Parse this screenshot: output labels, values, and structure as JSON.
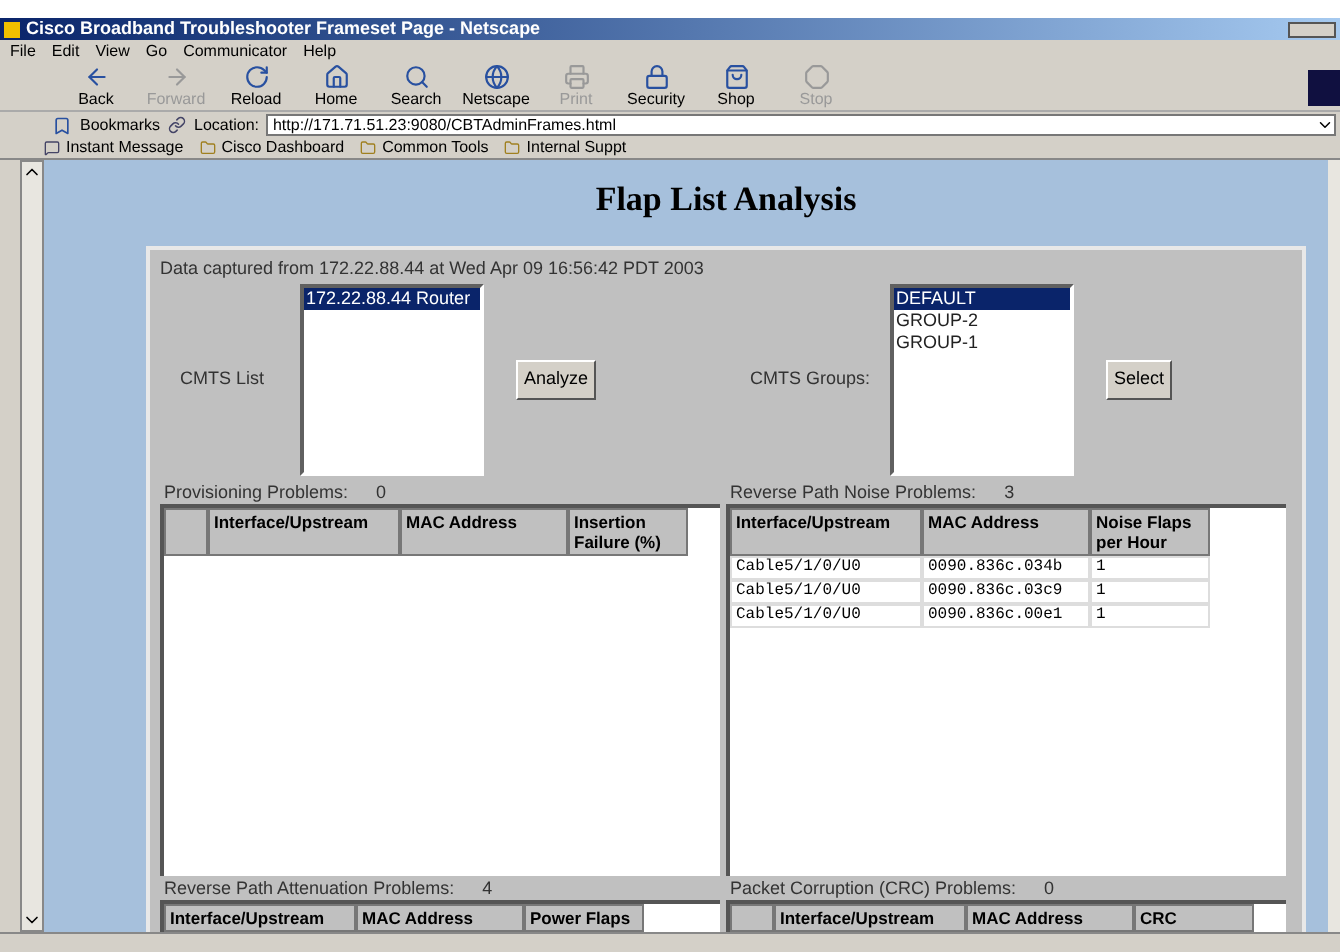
{
  "window": {
    "title": "Cisco Broadband Troubleshooter Frameset Page - Netscape"
  },
  "menu": [
    "File",
    "Edit",
    "View",
    "Go",
    "Communicator",
    "Help"
  ],
  "toolbar": [
    {
      "label": "Back",
      "disabled": false
    },
    {
      "label": "Forward",
      "disabled": true
    },
    {
      "label": "Reload",
      "disabled": false
    },
    {
      "label": "Home",
      "disabled": false
    },
    {
      "label": "Search",
      "disabled": false
    },
    {
      "label": "Netscape",
      "disabled": false
    },
    {
      "label": "Print",
      "disabled": true
    },
    {
      "label": "Security",
      "disabled": false
    },
    {
      "label": "Shop",
      "disabled": false
    },
    {
      "label": "Stop",
      "disabled": true
    }
  ],
  "location_bar": {
    "bookmarks": "Bookmarks",
    "location_label": "Location:",
    "url": "http://171.71.51.23:9080/CBTAdminFrames.html"
  },
  "personal_toolbar": [
    "Instant Message",
    "Cisco Dashboard",
    "Common Tools",
    "Internal Suppt"
  ],
  "page": {
    "heading": "Flap List Analysis",
    "capture_info": "Data captured from 172.22.88.44 at Wed Apr 09 16:56:42 PDT 2003",
    "cmts_list": {
      "label": "CMTS List",
      "items": [
        {
          "text": "172.22.88.44 Router",
          "selected": true
        }
      ],
      "button": "Analyze"
    },
    "cmts_groups": {
      "label": "CMTS Groups:",
      "items": [
        {
          "text": "DEFAULT",
          "selected": true
        },
        {
          "text": "GROUP-2",
          "selected": false
        },
        {
          "text": "GROUP-1",
          "selected": false
        }
      ],
      "button": "Select"
    },
    "panels": [
      {
        "title": "Provisioning Problems:",
        "count": "0",
        "select_column": true,
        "columns": [
          "Interface/Upstream",
          "MAC Address",
          "Insertion Failure (%)"
        ]
      },
      {
        "title": "Reverse Path Noise Problems:",
        "count": "3",
        "select_column": false,
        "columns": [
          "Interface/Upstream",
          "MAC Address",
          "Noise Flaps per Hour"
        ],
        "rows": [
          [
            "Cable5/1/0/U0",
            "0090.836c.034b",
            "1"
          ],
          [
            "Cable5/1/0/U0",
            "0090.836c.03c9",
            "1"
          ],
          [
            "Cable5/1/0/U0",
            "0090.836c.00e1",
            "1"
          ]
        ]
      },
      {
        "title": "Reverse Path Attenuation Problems:",
        "count": "4",
        "select_column": false,
        "columns": [
          "Interface/Upstream",
          "MAC Address",
          "Power Flaps"
        ]
      },
      {
        "title": "Packet Corruption (CRC) Problems:",
        "count": "0",
        "select_column": true,
        "columns": [
          "Interface/Upstream",
          "MAC Address",
          "CRC"
        ]
      }
    ]
  }
}
